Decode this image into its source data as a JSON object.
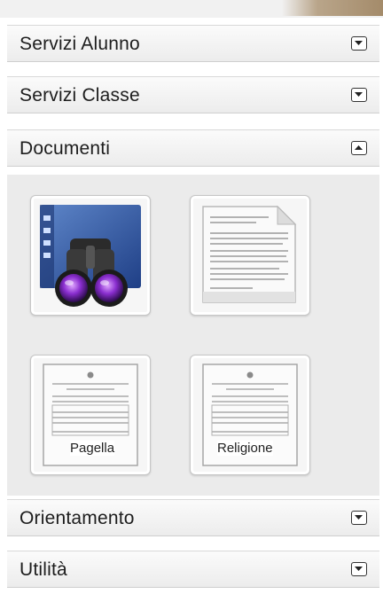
{
  "sections": {
    "servizi_alunno": {
      "label": "Servizi Alunno",
      "expanded": false
    },
    "servizi_classe": {
      "label": "Servizi Classe",
      "expanded": false
    },
    "documenti": {
      "label": "Documenti",
      "expanded": true
    },
    "orientamento": {
      "label": "Orientamento",
      "expanded": false
    },
    "utilita": {
      "label": "Utilità",
      "expanded": false
    }
  },
  "documenti_tiles": [
    {
      "icon": "binoculars-search-icon",
      "caption": ""
    },
    {
      "icon": "document-icon",
      "caption": ""
    },
    {
      "icon": "report-card-icon",
      "caption": "Pagella"
    },
    {
      "icon": "religion-report-icon",
      "caption": "Religione"
    }
  ],
  "colors": {
    "header_bg": "#f2f2f2",
    "content_bg": "#ebebeb",
    "accent": "#a48b6a"
  }
}
